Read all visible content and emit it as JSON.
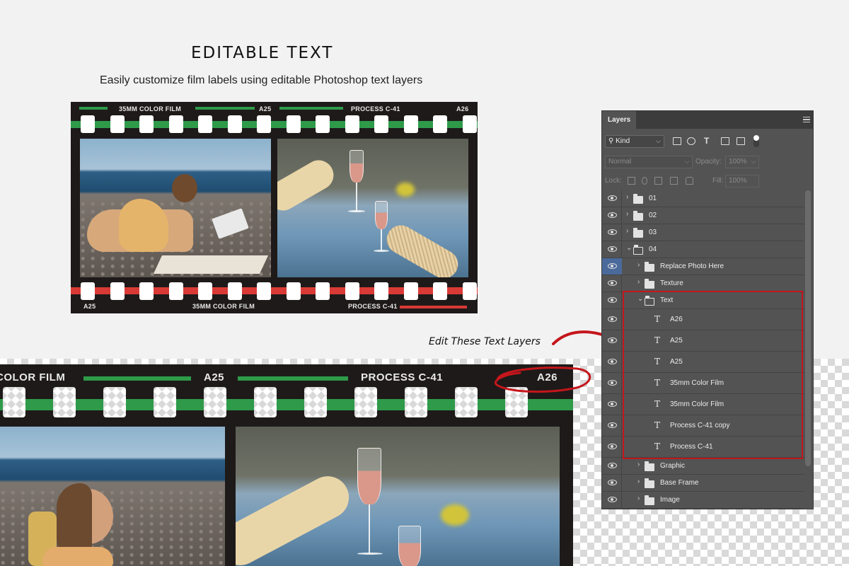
{
  "header": {
    "title": "EDITABLE TEXT",
    "subtitle": "Easily customize film labels using editable Photoshop text layers"
  },
  "film_small": {
    "top_labels": [
      "35MM COLOR FILM",
      "A25",
      "PROCESS C-41",
      "A26"
    ],
    "bottom_labels": [
      "A25",
      "35MM COLOR FILM",
      "PROCESS C-41"
    ],
    "top_stripe_color": "#2e9a4a",
    "bottom_stripe_color": "#d93a36"
  },
  "film_large": {
    "top_labels": [
      "COLOR FILM",
      "A25",
      "PROCESS C-41",
      "A26"
    ],
    "stripe_color": "#2e9a4a"
  },
  "annotation": {
    "text": "Edit These Text Layers",
    "accent_color": "#c4161c"
  },
  "layers_panel": {
    "tab": "Layers",
    "filter_kind": "Kind",
    "blend_mode": "Normal",
    "opacity_label": "Opacity:",
    "opacity_value": "100%",
    "lock_label": "Lock:",
    "fill_label": "Fill:",
    "fill_value": "100%",
    "layers": [
      {
        "name": "01",
        "type": "group",
        "expanded": false,
        "depth": 0,
        "icon": "folder-icon"
      },
      {
        "name": "02",
        "type": "group",
        "expanded": false,
        "depth": 0,
        "icon": "folder-icon"
      },
      {
        "name": "03",
        "type": "group",
        "expanded": false,
        "depth": 0,
        "icon": "folder-icon"
      },
      {
        "name": "04",
        "type": "group",
        "expanded": true,
        "depth": 0,
        "icon": "folder-icon"
      },
      {
        "name": "Replace Photo Here",
        "type": "group",
        "expanded": false,
        "depth": 1,
        "selected": true,
        "icon": "folder-icon"
      },
      {
        "name": "Texture",
        "type": "group",
        "expanded": false,
        "depth": 1,
        "icon": "folder-icon"
      },
      {
        "name": "Text",
        "type": "group",
        "expanded": true,
        "depth": 1,
        "icon": "folder-icon"
      },
      {
        "name": "A26",
        "type": "text",
        "depth": 2,
        "icon": "text-layer-icon"
      },
      {
        "name": "A25",
        "type": "text",
        "depth": 2,
        "icon": "text-layer-icon"
      },
      {
        "name": "A25",
        "type": "text",
        "depth": 2,
        "icon": "text-layer-icon"
      },
      {
        "name": "35mm Color Film",
        "type": "text",
        "depth": 2,
        "icon": "text-layer-icon"
      },
      {
        "name": "35mm Color Film",
        "type": "text",
        "depth": 2,
        "icon": "text-layer-icon"
      },
      {
        "name": "Process C-41 copy",
        "type": "text",
        "depth": 2,
        "icon": "text-layer-icon"
      },
      {
        "name": "Process C-41",
        "type": "text",
        "depth": 2,
        "icon": "text-layer-icon"
      },
      {
        "name": "Graphic",
        "type": "group",
        "expanded": false,
        "depth": 1,
        "icon": "folder-icon"
      },
      {
        "name": "Base Frame",
        "type": "group",
        "expanded": false,
        "depth": 1,
        "icon": "folder-icon"
      },
      {
        "name": "Image",
        "type": "group",
        "expanded": false,
        "depth": 1,
        "icon": "folder-icon"
      }
    ]
  }
}
